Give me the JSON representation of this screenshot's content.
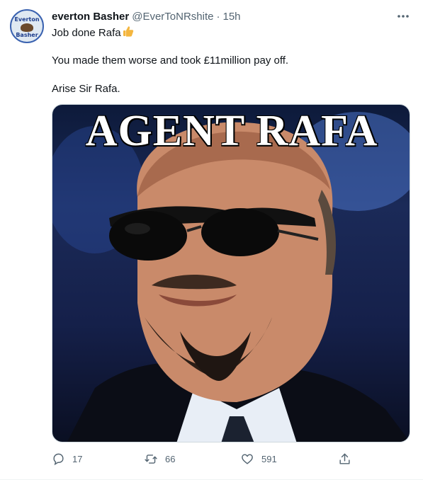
{
  "tweet": {
    "author_name": "everton Basher",
    "author_handle": "@EverToNRshite",
    "separator": "·",
    "time": "15h",
    "avatar_text_top": "Everton",
    "avatar_text_bottom": "Basher",
    "lines": [
      "Job done Rafa",
      "You made them worse and took £11million pay off.",
      "Arise Sir Rafa."
    ],
    "emoji": "thumbs-up-emoji",
    "media_caption": "AGENT RAFA",
    "stats": {
      "replies": "17",
      "retweets": "66",
      "likes": "591"
    }
  },
  "icons": {
    "more": "more-horizontal-icon",
    "reply": "reply-icon",
    "retweet": "retweet-icon",
    "like": "heart-icon",
    "share": "share-icon"
  },
  "colors": {
    "text": "#0f1419",
    "secondary": "#536471",
    "border": "#cfd9de",
    "emoji": "#f4b63f"
  }
}
